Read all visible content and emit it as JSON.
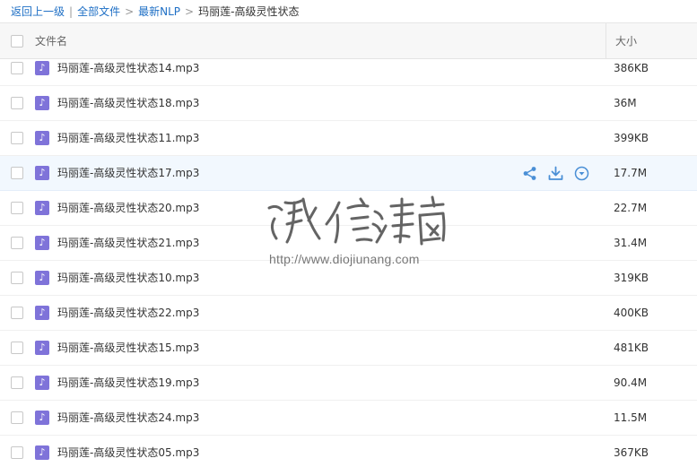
{
  "breadcrumb": {
    "back": "返回上一级",
    "all_files": "全部文件",
    "parent": "最新NLP",
    "current": "玛丽莲-高级灵性状态",
    "sep_bar": "|",
    "sep_arrow": ">"
  },
  "header": {
    "name_label": "文件名",
    "size_label": "大小"
  },
  "icons": {
    "file_type": "music-note-icon",
    "share": "share-icon",
    "download": "download-icon",
    "more": "chevron-down-circle-icon",
    "file_glyph": "♪"
  },
  "colors": {
    "link": "#1e6fc5",
    "hover_row": "#f2f8fe",
    "audio_icon": "#7f73d9",
    "action_icon": "#4a8fd6"
  },
  "files": [
    {
      "name": "玛丽莲-高级灵性状态14.mp3",
      "size": "386KB"
    },
    {
      "name": "玛丽莲-高级灵性状态18.mp3",
      "size": "36M"
    },
    {
      "name": "玛丽莲-高级灵性状态11.mp3",
      "size": "399KB"
    },
    {
      "name": "玛丽莲-高级灵性状态17.mp3",
      "size": "17.7M",
      "hovered": true
    },
    {
      "name": "玛丽莲-高级灵性状态20.mp3",
      "size": "22.7M"
    },
    {
      "name": "玛丽莲-高级灵性状态21.mp3",
      "size": "31.4M"
    },
    {
      "name": "玛丽莲-高级灵性状态10.mp3",
      "size": "319KB"
    },
    {
      "name": "玛丽莲-高级灵性状态22.mp3",
      "size": "400KB"
    },
    {
      "name": "玛丽莲-高级灵性状态15.mp3",
      "size": "481KB"
    },
    {
      "name": "玛丽莲-高级灵性状态19.mp3",
      "size": "90.4M"
    },
    {
      "name": "玛丽莲-高级灵性状态24.mp3",
      "size": "11.5M"
    },
    {
      "name": "玛丽莲-高级灵性状态05.mp3",
      "size": "367KB"
    }
  ],
  "watermark": {
    "logo_text": "诚信潮商",
    "url": "http://www.diojiunang.com"
  }
}
